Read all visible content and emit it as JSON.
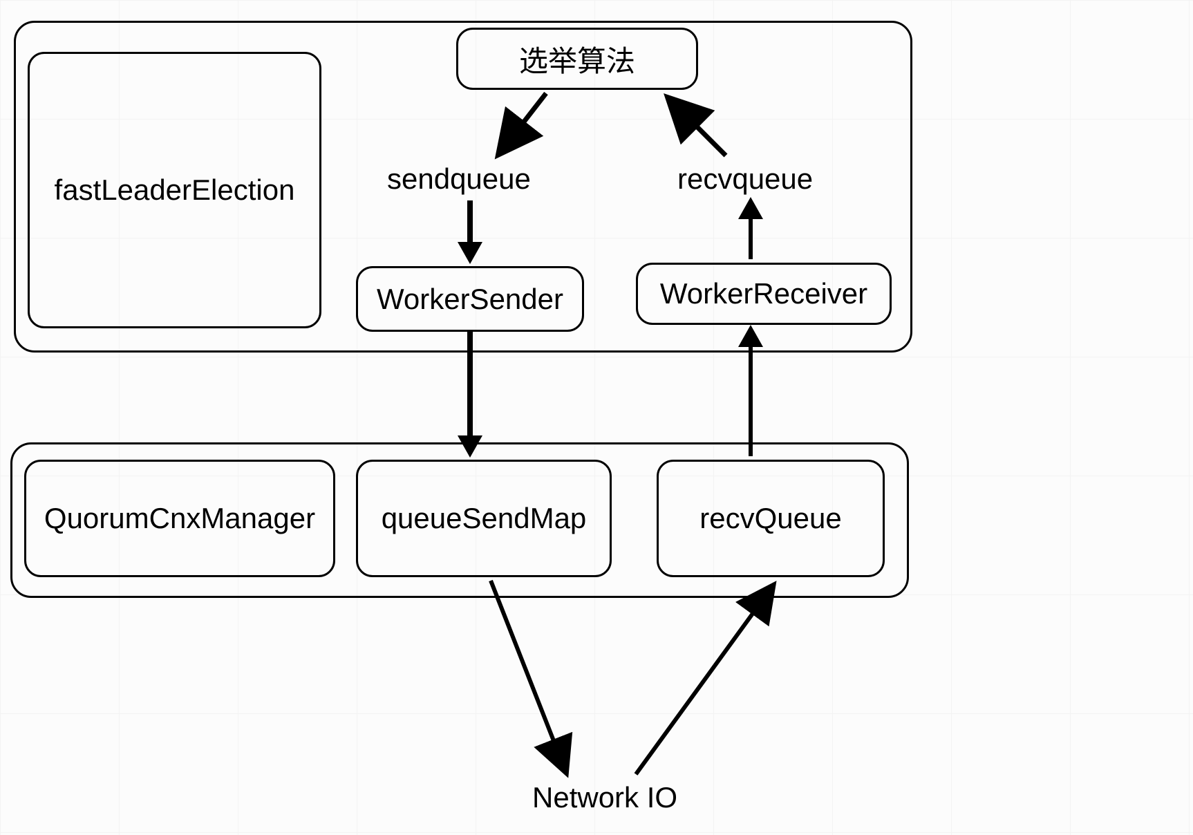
{
  "nodes": {
    "election_algo": "选举算法",
    "fast_leader_election": "fastLeaderElection",
    "sendqueue": "sendqueue",
    "recvqueue": "recvqueue",
    "worker_sender": "WorkerSender",
    "worker_receiver": "WorkerReceiver",
    "quorum_cnx_manager": "QuorumCnxManager",
    "queue_send_map": "queueSendMap",
    "recv_queue": "recvQueue",
    "network_io": "Network IO"
  }
}
